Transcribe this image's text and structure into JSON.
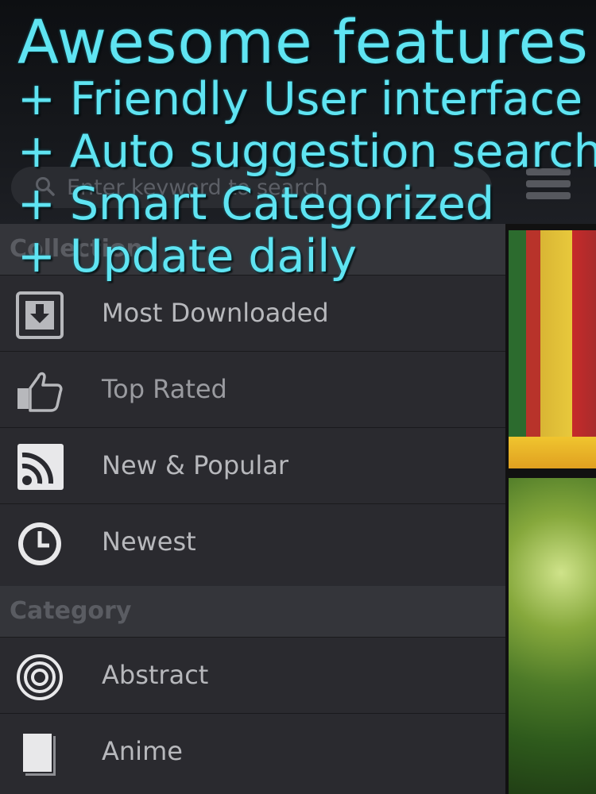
{
  "search": {
    "placeholder": "Enter keyword to search"
  },
  "sidebar": {
    "section_collection": "Collection",
    "items": [
      {
        "label": "Most Downloaded",
        "icon": "download-icon"
      },
      {
        "label": "Top Rated",
        "icon": "thumbs-up-icon"
      },
      {
        "label": "New & Popular",
        "icon": "rss-icon"
      },
      {
        "label": "Newest",
        "icon": "clock-icon"
      }
    ],
    "section_category": "Category",
    "categories": [
      {
        "label": "Abstract",
        "icon": "target-icon"
      },
      {
        "label": "Anime",
        "icon": "pages-icon"
      }
    ]
  },
  "headline": {
    "title": "Awesome features",
    "lines": [
      "+ Friendly User interface",
      "+ Auto suggestion search",
      "+ Smart Categorized",
      "+ Update daily"
    ]
  },
  "colors": {
    "headline": "#5fe4f2",
    "sidebar_bg": "#2a2a2f",
    "header_bg": "#34353a"
  }
}
